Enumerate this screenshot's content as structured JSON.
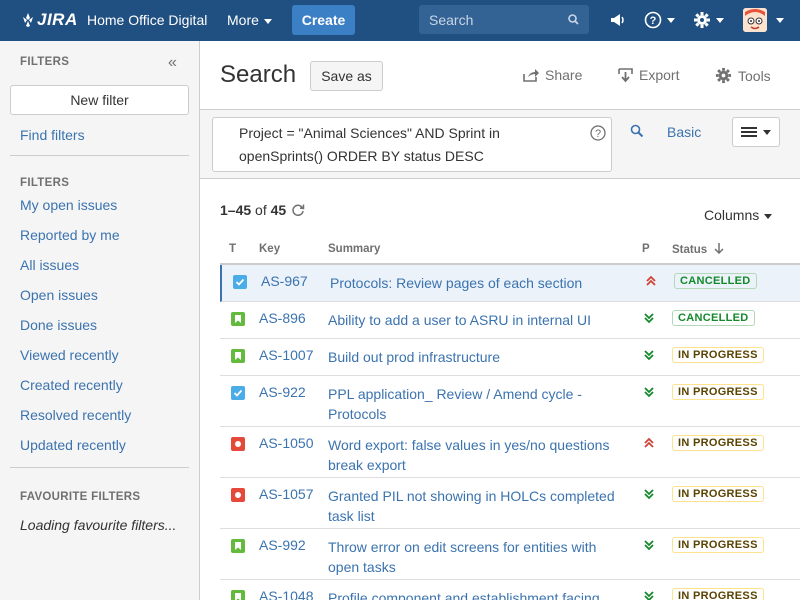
{
  "header": {
    "logo": "JIRA",
    "app_name": "Home Office Digital",
    "more": "More",
    "create": "Create",
    "search_placeholder": "Search",
    "brand_color": "#205081"
  },
  "sidebar": {
    "filters_heading": "FILTERS",
    "new_filter": "New filter",
    "find_filters": "Find filters",
    "filters_heading2": "FILTERS",
    "links": [
      "My open issues",
      "Reported by me",
      "All issues",
      "Open issues",
      "Done issues",
      "Viewed recently",
      "Created recently",
      "Resolved recently",
      "Updated recently"
    ],
    "favourite_heading": "FAVOURITE FILTERS",
    "favourite_loading": "Loading favourite filters..."
  },
  "main": {
    "title": "Search",
    "save_as": "Save as",
    "share": "Share",
    "export": "Export",
    "tools": "Tools",
    "jql": "Project = \"Animal Sciences\" AND Sprint in openSprints() ORDER BY status DESC",
    "basic": "Basic",
    "count_range": "1–45",
    "count_of": "of",
    "count_total": "45",
    "columns": "Columns"
  },
  "table": {
    "headers": {
      "type": "T",
      "key": "Key",
      "summary": "Summary",
      "priority": "P",
      "status": "Status"
    },
    "rows": [
      {
        "type": "task",
        "key": "AS-967",
        "summary": "Protocols: Review pages of each section",
        "priority": "high",
        "status": "CANCELLED"
      },
      {
        "type": "story",
        "key": "AS-896",
        "summary": "Ability to add a user to ASRU in internal UI",
        "priority": "low",
        "status": "CANCELLED"
      },
      {
        "type": "story",
        "key": "AS-1007",
        "summary": "Build out prod infrastructure",
        "priority": "low",
        "status": "IN PROGRESS"
      },
      {
        "type": "task",
        "key": "AS-922",
        "summary": "PPL application_ Review / Amend cycle - Protocols",
        "priority": "low",
        "status": "IN PROGRESS"
      },
      {
        "type": "bug",
        "key": "AS-1050",
        "summary": "Word export: false values in yes/no questions break export",
        "priority": "high",
        "status": "IN PROGRESS"
      },
      {
        "type": "bug",
        "key": "AS-1057",
        "summary": "Granted PIL not showing in HOLCs completed task list",
        "priority": "low",
        "status": "IN PROGRESS"
      },
      {
        "type": "story",
        "key": "AS-992",
        "summary": "Throw error on edit screens for entities with open tasks",
        "priority": "low",
        "status": "IN PROGRESS"
      },
      {
        "type": "story",
        "key": "AS-1048",
        "summary": "Profile component and establishment facing",
        "priority": "low",
        "status": "IN PROGRESS"
      }
    ]
  }
}
